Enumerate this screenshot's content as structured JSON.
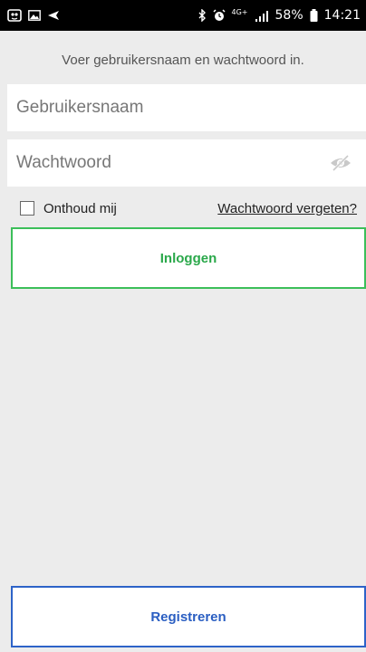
{
  "status_bar": {
    "time": "14:21",
    "battery": "58%",
    "network": "4G+",
    "icons": [
      "notification-icon",
      "image-icon",
      "navigation-icon",
      "bluetooth-icon",
      "alarm-icon",
      "network-4g-icon",
      "signal-icon",
      "battery-icon"
    ]
  },
  "login": {
    "instruction": "Voer gebruikersnaam en wachtwoord in.",
    "username_placeholder": "Gebruikersnaam",
    "password_placeholder": "Wachtwoord",
    "remember_label": "Onthoud mij",
    "remember_checked": false,
    "forgot_link": "Wachtwoord vergeten?",
    "login_button": "Inloggen",
    "register_button": "Registreren"
  },
  "colors": {
    "login_accent": "#3cbf5a",
    "register_accent": "#2d63c8",
    "background": "#ececec"
  }
}
